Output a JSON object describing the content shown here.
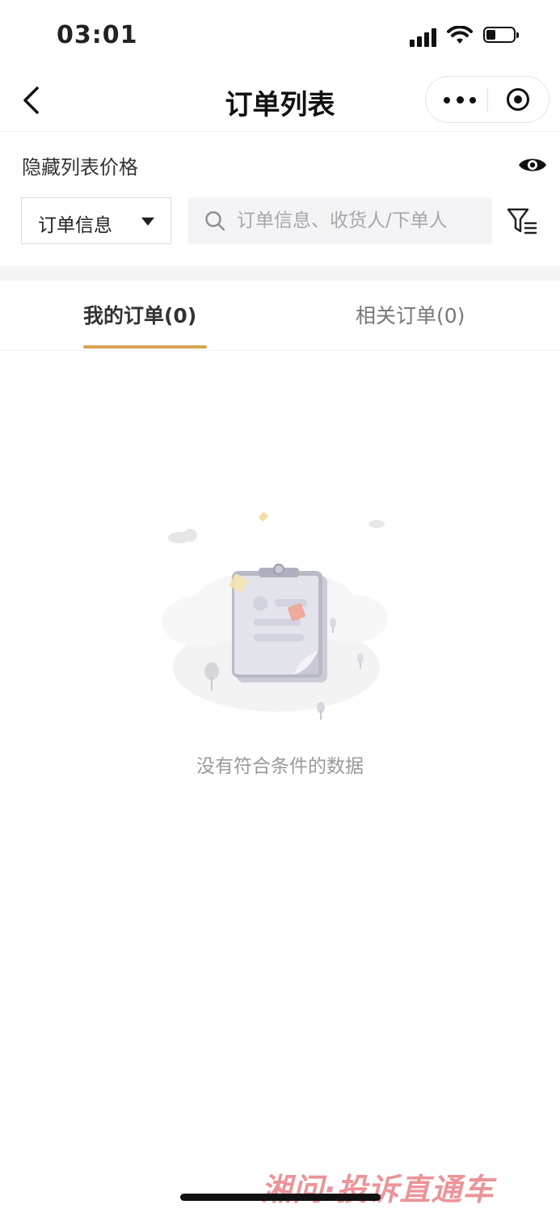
{
  "status_bar": {
    "time": "03:01"
  },
  "nav": {
    "title": "订单列表",
    "back_icon": "chevron-left-icon",
    "more_icon": "more-dots-icon",
    "close_icon": "target-circle-icon"
  },
  "hide_price": {
    "label": "隐藏列表价格",
    "icon": "eye-icon"
  },
  "search": {
    "dropdown_value": "订单信息",
    "placeholder": "订单信息、收货人/下单人",
    "search_icon": "search-icon",
    "filter_icon": "filter-list-icon"
  },
  "tabs": [
    {
      "label": "我的订单(0)",
      "active": true
    },
    {
      "label": "相关订单(0)",
      "active": false
    }
  ],
  "empty_state": {
    "message": "没有符合条件的数据"
  },
  "watermark": "湘问·投诉直通车",
  "colors": {
    "accent": "#d7a352",
    "watermark": "#dc3c46"
  }
}
